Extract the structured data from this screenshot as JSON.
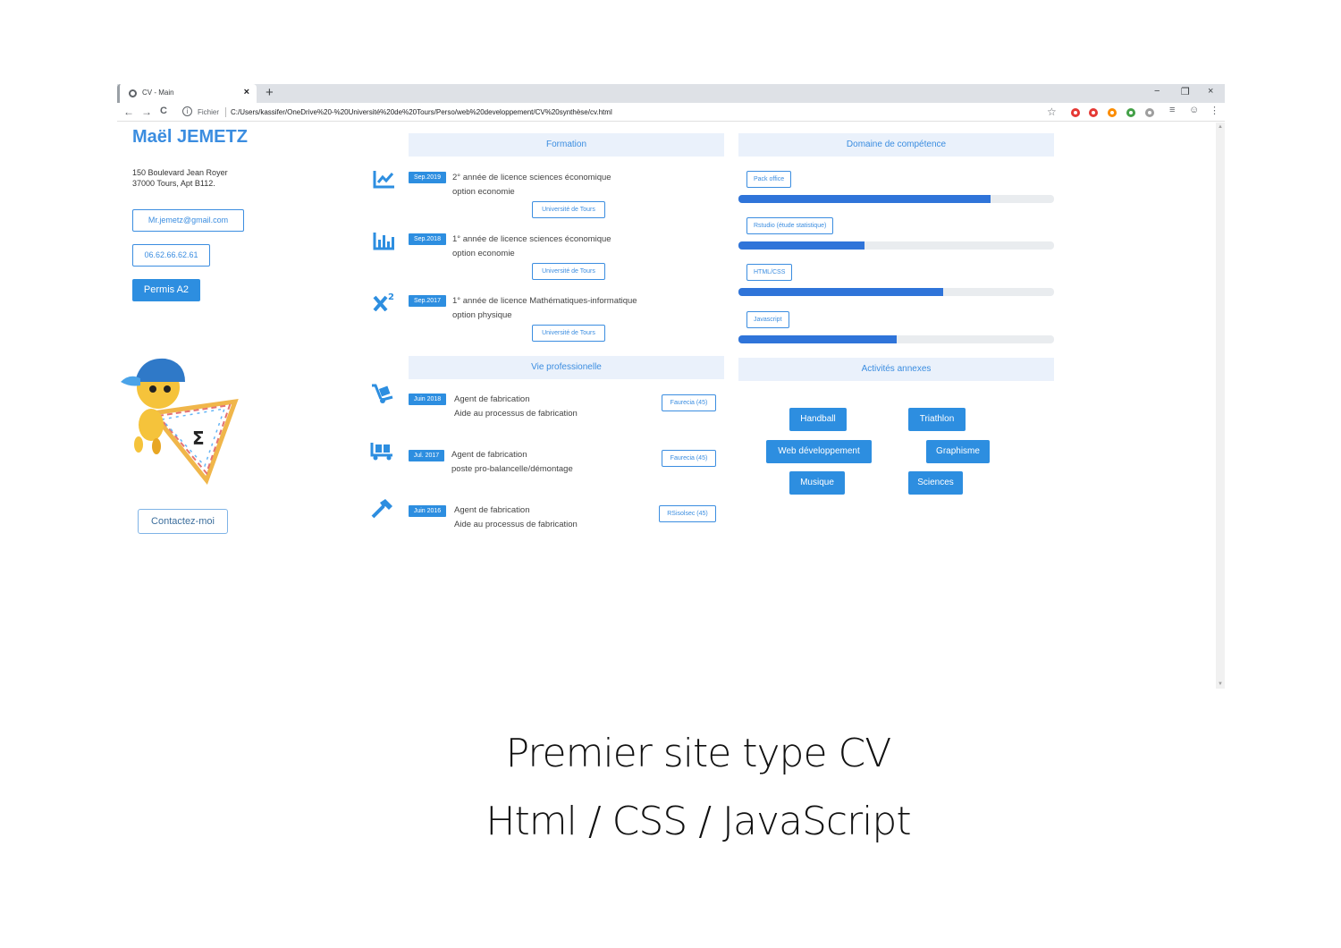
{
  "browser": {
    "tab_title": "CV - Main",
    "tab_close": "×",
    "new_tab": "+",
    "minimize": "−",
    "restore": "❐",
    "close": "×",
    "back": "←",
    "forward": "→",
    "reload": "C",
    "info": "i",
    "scheme": "Fichier",
    "url": "C:/Users/kassifer/OneDrive%20-%20Université%20de%20Tours/Perso/web%20developpement/CV%20synthèse/cv.html",
    "star": "☆",
    "ext_colors": [
      "#e53935",
      "#e53935",
      "#fb8c00",
      "#43a047",
      "#9e9e9e"
    ]
  },
  "profile": {
    "name": "Maël JEMETZ",
    "address_line1": "150 Boulevard Jean Royer",
    "address_line2": "37000 Tours, Apt B112.",
    "email": "Mr.jemetz@gmail.com",
    "phone": "06.62.66.62.61",
    "permis": "Permis A2",
    "contact": "Contactez-moi",
    "mascot_symbol": "Σ"
  },
  "formation": {
    "title": "Formation",
    "items": [
      {
        "date": "Sep.2019",
        "line1": "2° année de licence sciences économique",
        "line2": "option economie",
        "school": "Université de Tours",
        "icon": "chart-line-icon"
      },
      {
        "date": "Sep.2018",
        "line1": "1° année de licence sciences économique",
        "line2": "option economie",
        "school": "Université de Tours",
        "icon": "chart-bar-icon"
      },
      {
        "date": "Sep.2017",
        "line1": "1° année de licence Mathématiques-informatique",
        "line2": "option physique",
        "school": "Université de Tours",
        "icon": "superscript-icon"
      }
    ]
  },
  "pro": {
    "title": "Vie professionelle",
    "items": [
      {
        "date": "Juin 2018",
        "line1": "Agent de fabrication",
        "line2": "Aide au processus de fabrication",
        "company": "Faurecia (45)",
        "icon": "dolly-icon"
      },
      {
        "date": "Jul. 2017",
        "line1": "Agent de fabrication",
        "line2": "poste pro-balancelle/démontage",
        "company": "Faurecia (45)",
        "icon": "pallet-icon"
      },
      {
        "date": "Juin 2016",
        "line1": "Agent de fabrication",
        "line2": "Aide au processus de fabrication",
        "company": "RSisolsec (45)",
        "icon": "hammer-icon"
      }
    ]
  },
  "skills": {
    "title": "Domaine de compétence",
    "items": [
      {
        "label": "Pack office",
        "level": 0.8
      },
      {
        "label": "Rstudio (étude statistique)",
        "level": 0.4
      },
      {
        "label": "HTML/CSS",
        "level": 0.65
      },
      {
        "label": "Javascript",
        "level": 0.5
      }
    ]
  },
  "activities": {
    "title": "Activités annexes",
    "items": [
      "Handball",
      "Triathlon",
      "Web développement",
      "Graphisme",
      "Musique",
      "Sciences"
    ]
  },
  "caption": {
    "line1": "Premier site type CV",
    "line2": "Html / CSS / JavaScript"
  }
}
